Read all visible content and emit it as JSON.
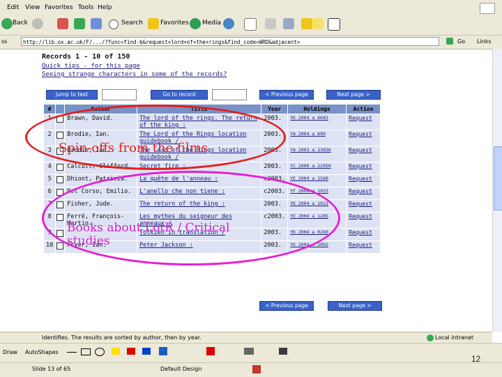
{
  "menu": [
    "Edit",
    "View",
    "Favorites",
    "Tools",
    "Help"
  ],
  "toolbar": {
    "back_label": "Back",
    "search_label": "Search",
    "favorites_label": "Favorites",
    "media_label": "Media"
  },
  "address": {
    "url": "http://lib.ox.ac.uk/F/.../?func=find-b&request=lord+of+the+rings&find_code=WRD&adjacent=",
    "go_label": "Go",
    "links_label": "Links"
  },
  "page": {
    "records": "Records 1 - 10 of 150",
    "hint1": "Quick tips - for this page",
    "hint2": "Seeing strange characters in some of the records?",
    "jump_to_text": "Jump to text",
    "go_to_record": "Go to record",
    "previous_page": "< Previous page",
    "next_page": "Next page >"
  },
  "table": {
    "headers": [
      "#",
      "",
      "Author",
      "Title",
      "Year",
      "Holdings",
      "Action"
    ],
    "rows": [
      {
        "num": "1",
        "author": "Brawn, David.",
        "title": "The lord of the rings. The return of the king :",
        "year": "2003.",
        "holdings": "YK 2004 a 6043",
        "action": "Request"
      },
      {
        "num": "2",
        "author": "Brodie, Ian.",
        "title": "The Lord of the Rings location guidebook /",
        "year": "2003.",
        "holdings": "YA 2004 a 690",
        "action": "Request"
      },
      {
        "num": "3",
        "author": "Brodie, Ian.",
        "title": "The Lord of the Rings location guidebook /",
        "year": "2003.",
        "holdings": "YA 2003 a 13836",
        "action": "Request"
      },
      {
        "num": "4",
        "author": "Calcutt, Clifford.",
        "title": "Secret fire :",
        "year": "2003.",
        "holdings": "YC 2000 a 22050",
        "action": "Request"
      },
      {
        "num": "5",
        "author": "Dhiont, Patricia.",
        "title": "La quête de l'anneau :",
        "year": "c2003.",
        "holdings": "YE 2004 a 1560",
        "action": "Request"
      },
      {
        "num": "6",
        "author": "Del Corso, Emilio.",
        "title": "L'anello che non tiene :",
        "year": "c2003.",
        "holdings": "YF 2004 a 1023",
        "action": "Request"
      },
      {
        "num": "7",
        "author": "Fisher, Jude.",
        "title": "The return of the king :",
        "year": "2003.",
        "holdings": "YK 2004 a 1022",
        "action": "Request"
      },
      {
        "num": "8",
        "author": "Ferré, François-Martin.",
        "title": "Les mythes du seigneur des anneaux /",
        "year": "c2003.",
        "holdings": "YE 2004 a 1285",
        "action": "Request"
      },
      {
        "num": "9",
        "author": "",
        "title": "Tolkien in translation /",
        "year": "2003.",
        "holdings": "YK 2004 a 0260",
        "action": "Request"
      },
      {
        "num": "10",
        "author": "Fryer, Ian.",
        "title": "Peter Jackson :",
        "year": "2003.",
        "holdings": "YK 2004 a 2092",
        "action": "Request"
      }
    ]
  },
  "annotations": {
    "films": "Spin-offs from the films",
    "critical": "Books about LotR / Critical studies"
  },
  "status": {
    "left": "Identifies. The results are sorted by author, then by year.",
    "zone": "Local intranet"
  },
  "draw": {
    "draw_label": "Draw",
    "autoshapes_label": "AutoShapes"
  },
  "ppt": {
    "slide": "Slide 13 of 65",
    "design": "Default Design",
    "page_number": "12"
  }
}
